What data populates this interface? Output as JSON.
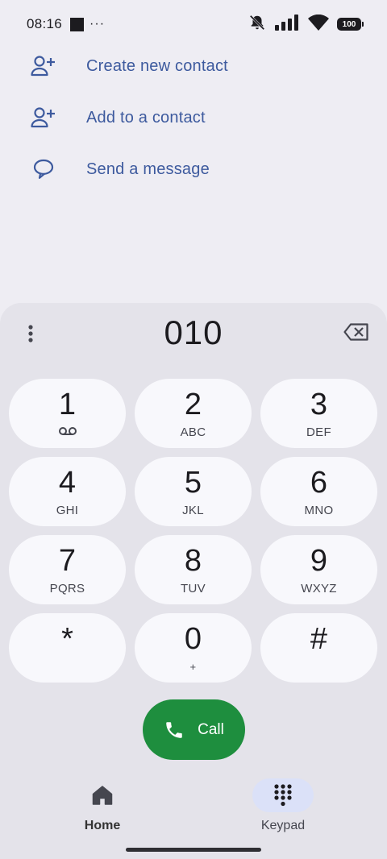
{
  "status_bar": {
    "time": "08:16",
    "dots": "···",
    "battery": "100",
    "icons": [
      "notifications-off-icon",
      "signal-icon",
      "wifi-icon",
      "battery-icon"
    ]
  },
  "actions": [
    {
      "label": "Create new contact",
      "icon": "person-add-icon"
    },
    {
      "label": "Add to a contact",
      "icon": "person-add-icon"
    },
    {
      "label": "Send a message",
      "icon": "message-icon"
    }
  ],
  "dialer": {
    "number": "010",
    "keys": [
      {
        "digit": "1",
        "sub": ""
      },
      {
        "digit": "2",
        "sub": "ABC"
      },
      {
        "digit": "3",
        "sub": "DEF"
      },
      {
        "digit": "4",
        "sub": "GHI"
      },
      {
        "digit": "5",
        "sub": "JKL"
      },
      {
        "digit": "6",
        "sub": "MNO"
      },
      {
        "digit": "7",
        "sub": "PQRS"
      },
      {
        "digit": "8",
        "sub": "TUV"
      },
      {
        "digit": "9",
        "sub": "WXYZ"
      },
      {
        "digit": "*",
        "sub": ""
      },
      {
        "digit": "0",
        "sub": "+"
      },
      {
        "digit": "#",
        "sub": ""
      }
    ],
    "call_label": "Call"
  },
  "nav": {
    "home_label": "Home",
    "keypad_label": "Keypad",
    "active": "Keypad"
  },
  "colors": {
    "accent_text": "#3d5a9e",
    "call_green": "#1e8e3e",
    "active_pill": "#dbe1f8"
  }
}
